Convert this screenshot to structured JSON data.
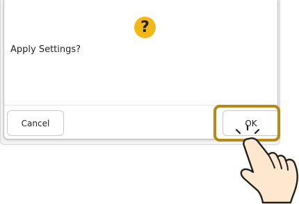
{
  "dialog": {
    "icon": "question-icon",
    "icon_glyph": "?",
    "message": "Apply Settings?",
    "cancel_label": "Cancel",
    "ok_label": "OK"
  },
  "colors": {
    "icon_background": "#f2b719",
    "highlight_border": "#b58a17",
    "hand_fill": "#fde7cf"
  },
  "pointer": {
    "icon": "tapping-hand-icon"
  }
}
